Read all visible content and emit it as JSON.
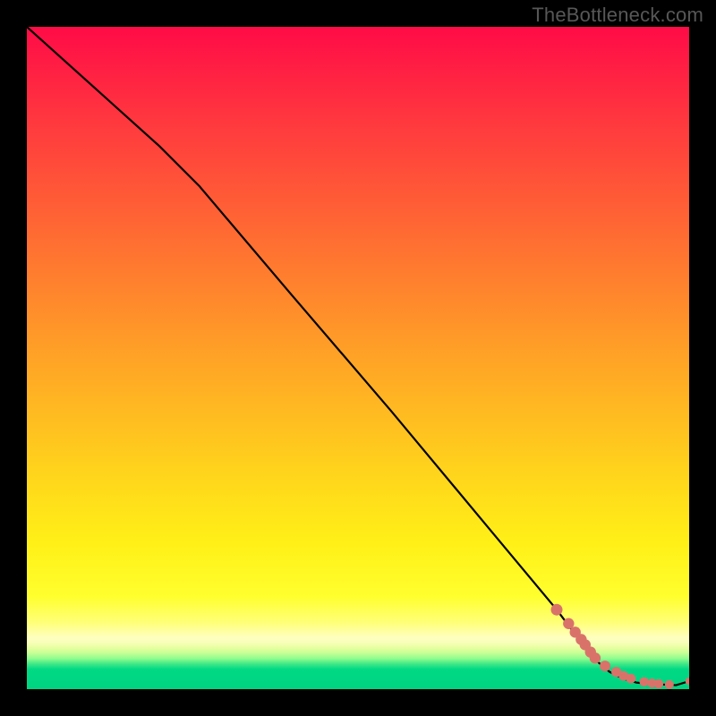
{
  "watermark": "TheBottleneck.com",
  "colors": {
    "background": "#000000",
    "marker": "#d9736a",
    "curve": "#000000"
  },
  "chart_data": {
    "type": "line",
    "title": "",
    "xlabel": "",
    "ylabel": "",
    "xlim": [
      0,
      100
    ],
    "ylim": [
      0,
      100
    ],
    "grid": false,
    "legend": false,
    "series": [
      {
        "name": "bottleneck-curve",
        "x": [
          0.0,
          10.0,
          20.0,
          26.0,
          40.0,
          55.0,
          70.0,
          80.0,
          83.0,
          85.5,
          88.0,
          90.0,
          92.0,
          94.0,
          96.0,
          98.0,
          100.0
        ],
        "y": [
          100.0,
          91.0,
          82.0,
          76.0,
          59.5,
          42.0,
          24.0,
          12.0,
          8.0,
          4.7,
          2.6,
          1.6,
          1.0,
          0.8,
          0.7,
          0.6,
          1.2
        ]
      }
    ],
    "markers": {
      "name": "recommended-points",
      "color": "#d9736a",
      "x": [
        80.0,
        81.8,
        82.8,
        83.7,
        84.3,
        85.1,
        85.8,
        87.3,
        89.0,
        90.1,
        91.2,
        93.2,
        94.4,
        95.4,
        97.0,
        100.0
      ],
      "y": [
        12.0,
        9.9,
        8.6,
        7.5,
        6.7,
        5.6,
        4.7,
        3.5,
        2.6,
        2.0,
        1.6,
        1.1,
        0.9,
        0.8,
        0.7,
        1.2
      ],
      "r": [
        6.5,
        6.2,
        6.2,
        6.2,
        6.2,
        6.2,
        6.2,
        6.0,
        5.6,
        5.4,
        5.4,
        5.2,
        5.2,
        5.2,
        5.0,
        4.2
      ]
    },
    "gradient_stops": [
      {
        "pct": 0,
        "color": "#ff0b47"
      },
      {
        "pct": 50,
        "color": "#ffa326"
      },
      {
        "pct": 86,
        "color": "#ffff2e"
      },
      {
        "pct": 97,
        "color": "#00d985"
      },
      {
        "pct": 100,
        "color": "#00d481"
      }
    ]
  }
}
